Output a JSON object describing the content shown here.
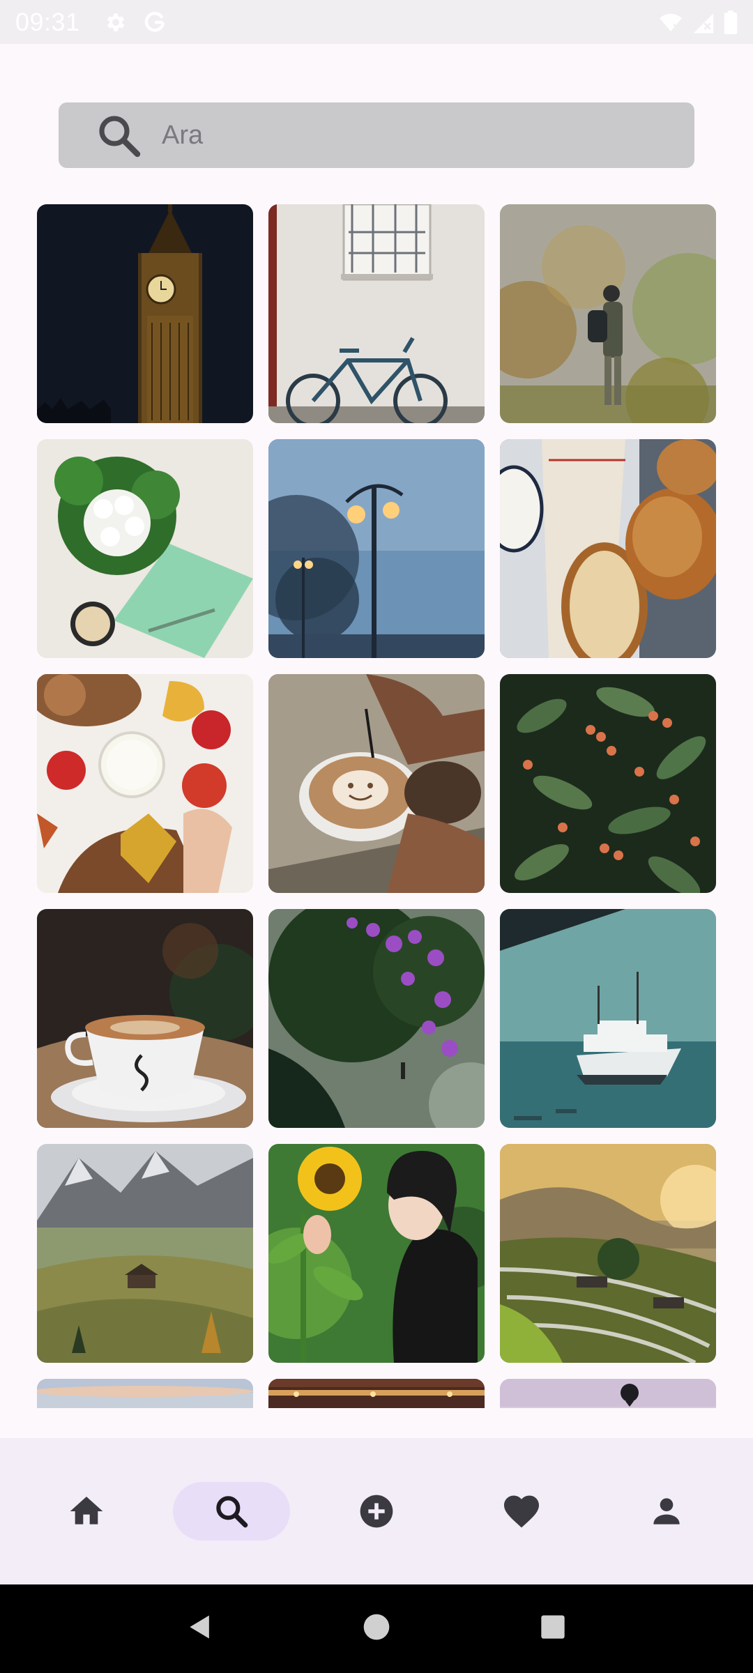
{
  "status_bar": {
    "time": "09:31",
    "left_icons": [
      "gear-icon",
      "google-g-icon"
    ],
    "right_icons": [
      "wifi-off-icon",
      "signal-off-icon",
      "battery-icon"
    ]
  },
  "search": {
    "placeholder": "Ara",
    "value": "",
    "icon": "search-icon"
  },
  "photos": [
    {
      "subject": "big-ben-clock-tower"
    },
    {
      "subject": "bicycle-white-wall"
    },
    {
      "subject": "hiker-foggy-forest"
    },
    {
      "subject": "white-flowers-coffee"
    },
    {
      "subject": "snowy-street-lamp"
    },
    {
      "subject": "bread-loaf"
    },
    {
      "subject": "apples-milk-autumn"
    },
    {
      "subject": "latte-art"
    },
    {
      "subject": "berry-tree"
    },
    {
      "subject": "coffee-cup"
    },
    {
      "subject": "purple-flowering-tree"
    },
    {
      "subject": "ferry-at-sea"
    },
    {
      "subject": "mountain-meadow"
    },
    {
      "subject": "woman-sunflower"
    },
    {
      "subject": "rice-terraces-sunset"
    },
    {
      "subject": "pastel-sky"
    },
    {
      "subject": "warm-lit-interior"
    },
    {
      "subject": "hot-air-balloon"
    }
  ],
  "bottom_nav": {
    "items": [
      {
        "id": "home",
        "icon": "home-icon",
        "active": false
      },
      {
        "id": "search",
        "icon": "search-icon",
        "active": true
      },
      {
        "id": "add",
        "icon": "add-circle-icon",
        "active": false
      },
      {
        "id": "favorites",
        "icon": "heart-icon",
        "active": false
      },
      {
        "id": "profile",
        "icon": "person-icon",
        "active": false
      }
    ]
  },
  "system_nav": {
    "items": [
      "back-icon",
      "home-circle-icon",
      "recents-square-icon"
    ]
  },
  "colors": {
    "background": "#fdf8fc",
    "search_bar": "#c9c8cb",
    "nav_background": "#f3edf7",
    "nav_active_pill": "#e8def8",
    "nav_icon": "#3b3a40"
  }
}
